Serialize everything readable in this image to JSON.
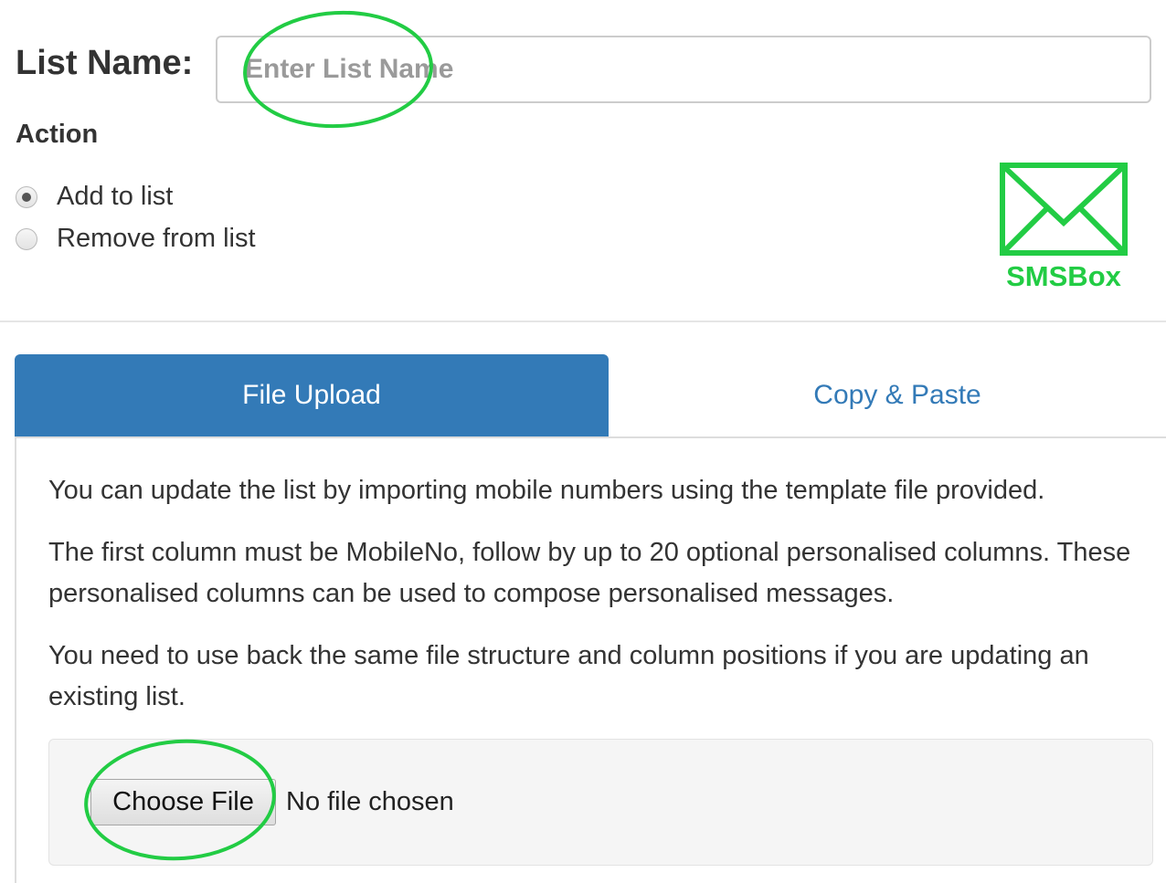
{
  "form": {
    "list_name_label": "List Name:",
    "list_name_placeholder": "Enter List Name",
    "list_name_value": "",
    "action_heading": "Action",
    "action_options": [
      {
        "label": "Add to list",
        "selected": true
      },
      {
        "label": "Remove from list",
        "selected": false
      }
    ]
  },
  "logo": {
    "text": "SMSBox",
    "icon": "envelope-icon",
    "color": "#22cc44"
  },
  "tabs": [
    {
      "label": "File Upload",
      "active": true
    },
    {
      "label": "Copy & Paste",
      "active": false
    }
  ],
  "file_upload": {
    "paragraphs": [
      "You can update the list by importing mobile numbers using the template file provided.",
      "The first column must be MobileNo, follow by up to 20 optional personalised columns. These personalised columns can be used to compose personalised messages.",
      "You need to use back the same file structure and column positions if you are updating an existing list."
    ],
    "choose_file_label": "Choose File",
    "file_status": "No file chosen"
  },
  "colors": {
    "tab_active": "#337ab7",
    "link": "#337ab7",
    "annotation": "#22cc44"
  }
}
